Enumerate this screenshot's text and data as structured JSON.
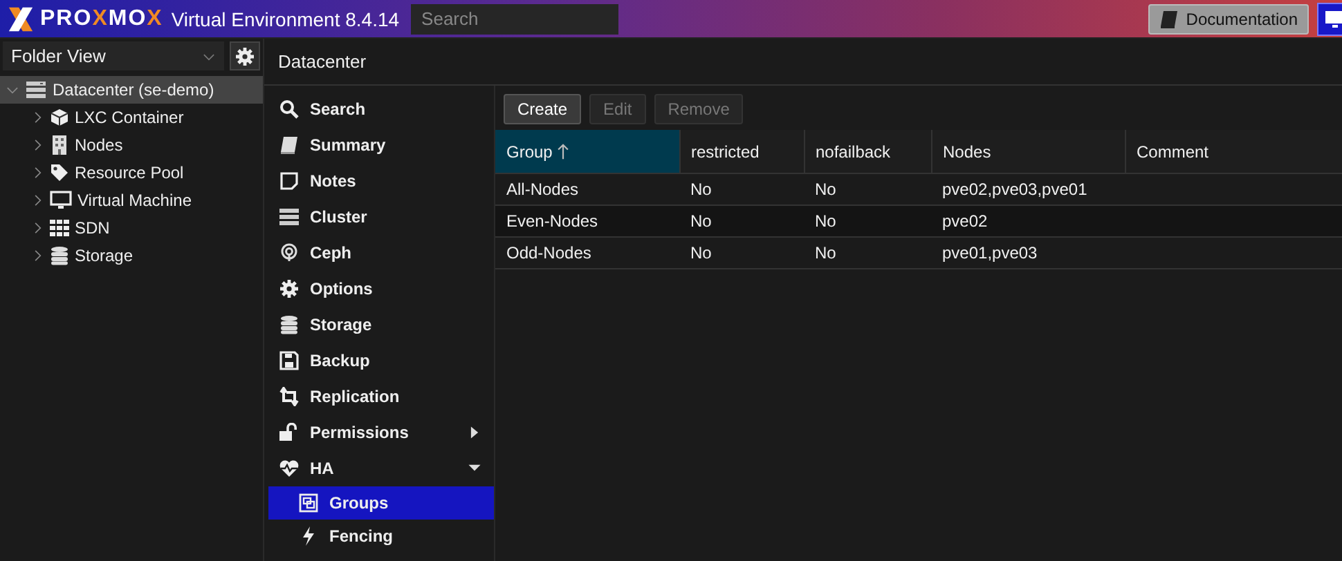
{
  "header": {
    "logo": "PROXMOX",
    "product": "Virtual Environment 8.4.14",
    "search": {
      "placeholder": "Search"
    },
    "documentation_button": "Documentation"
  },
  "view_selector": {
    "value": "Folder View"
  },
  "tree": [
    {
      "label": "Datacenter (se-demo)",
      "selected": true,
      "expanded": true,
      "children": [
        {
          "label": "LXC Container",
          "selected": false,
          "expanded": false
        },
        {
          "label": "Nodes",
          "selected": false,
          "expanded": false
        },
        {
          "label": "Resource Pool",
          "selected": false,
          "expanded": false
        },
        {
          "label": "Virtual Machine",
          "selected": false,
          "expanded": false
        },
        {
          "label": "SDN",
          "selected": false,
          "expanded": false
        },
        {
          "label": "Storage",
          "selected": false,
          "expanded": false
        }
      ]
    }
  ],
  "panel_title": "Datacenter",
  "nav": [
    {
      "label": "Search",
      "selected": false
    },
    {
      "label": "Summary",
      "selected": false
    },
    {
      "label": "Notes",
      "selected": false
    },
    {
      "label": "Cluster",
      "selected": false
    },
    {
      "label": "Ceph",
      "selected": false
    },
    {
      "label": "Options",
      "selected": false
    },
    {
      "label": "Storage",
      "selected": false
    },
    {
      "label": "Backup",
      "selected": false
    },
    {
      "label": "Replication",
      "selected": false
    },
    {
      "label": "Permissions",
      "selected": false,
      "expanded": false
    },
    {
      "label": "HA",
      "selected": false,
      "expanded": true,
      "children": [
        {
          "label": "Groups",
          "selected": true
        },
        {
          "label": "Fencing",
          "selected": false
        }
      ]
    }
  ],
  "toolbar": [
    {
      "label": "Create",
      "disabled": false
    },
    {
      "label": "Edit",
      "disabled": true
    },
    {
      "label": "Remove",
      "disabled": true
    }
  ],
  "table": {
    "columns": [
      {
        "label": "Group",
        "sorted": true
      },
      {
        "label": "restricted",
        "sorted": false
      },
      {
        "label": "nofailback",
        "sorted": false
      },
      {
        "label": "Nodes",
        "sorted": false
      },
      {
        "label": "Comment",
        "sorted": false
      }
    ],
    "rows": [
      [
        "All-Nodes",
        "No",
        "No",
        "pve02,pve03,pve01"
      ],
      [
        "Even-Nodes",
        "No",
        "No",
        "pve02"
      ],
      [
        "Odd-Nodes",
        "No",
        "No",
        "pve01,pve03"
      ]
    ]
  }
}
